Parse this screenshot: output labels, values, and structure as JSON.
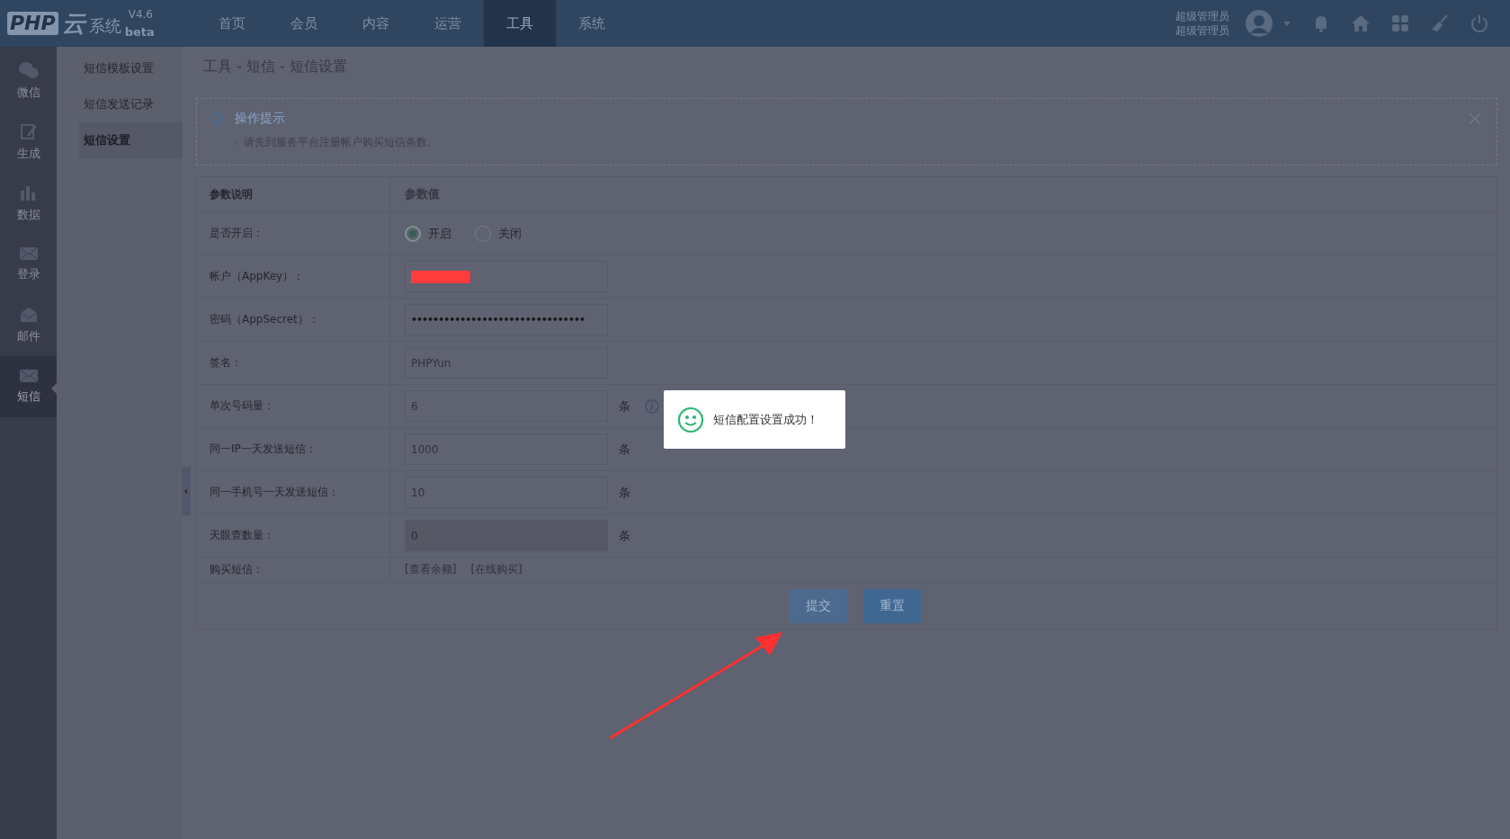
{
  "header": {
    "logo": {
      "mark": "PHP",
      "glyph": "云",
      "name": "系统",
      "version": "V4.6",
      "tag": "beta"
    },
    "nav": [
      {
        "label": "首页",
        "selected": false
      },
      {
        "label": "会员",
        "selected": false
      },
      {
        "label": "内容",
        "selected": false
      },
      {
        "label": "运营",
        "selected": false
      },
      {
        "label": "工具",
        "selected": true
      },
      {
        "label": "系统",
        "selected": false
      }
    ],
    "user": {
      "line_1": "超级管理员",
      "line_2": "超级管理员"
    }
  },
  "sidebar": {
    "items": [
      {
        "label": "微信",
        "selected": false
      },
      {
        "label": "生成",
        "selected": false
      },
      {
        "label": "数据",
        "selected": false
      },
      {
        "label": "登录",
        "selected": false
      },
      {
        "label": "邮件",
        "selected": false
      },
      {
        "label": "短信",
        "selected": true
      }
    ]
  },
  "collapse_handle": "‹",
  "submenu": {
    "items": [
      {
        "label": "短信模板设置",
        "selected": false
      },
      {
        "label": "短信发送记录",
        "selected": false
      },
      {
        "label": "短信设置",
        "selected": true
      }
    ]
  },
  "breadcrumb": "工具 - 短信 - 短信设置",
  "tip": {
    "title": "操作提示",
    "items": [
      "请先到服务平台注册帐户购买短信条数。"
    ]
  },
  "table": {
    "columns": [
      "参数说明",
      "参数值"
    ],
    "rows": [
      {
        "label": "是否开启：",
        "kind": "radio",
        "options": [
          {
            "label": "开启",
            "selected": true
          },
          {
            "label": "关闭",
            "selected": false
          }
        ]
      },
      {
        "label": "帐户（AppKey）：",
        "kind": "field",
        "redacted": true
      },
      {
        "label": "密码（AppSecret）：",
        "kind": "field",
        "value": "••••••••••••••••••••••••••••••••"
      },
      {
        "label": "签名：",
        "kind": "field",
        "value": "PHPYun"
      },
      {
        "label": "单次号码量：",
        "kind": "field",
        "value": "6",
        "unit": "条",
        "info": true
      },
      {
        "label": "同一IP一天发送短信：",
        "kind": "field",
        "value": "1000",
        "unit": "条"
      },
      {
        "label": "同一手机号一天发送短信：",
        "kind": "field",
        "value": "10",
        "unit": "条"
      },
      {
        "label": "天眼查数量：",
        "kind": "field",
        "value": "0",
        "unit": "条",
        "disabled": true
      },
      {
        "label": "购买短信：",
        "kind": "links",
        "links": [
          "[查看余额]",
          "[在线购买]"
        ]
      }
    ]
  },
  "buttons": [
    {
      "label": "提交",
      "kind": "submit"
    },
    {
      "label": "重置",
      "kind": "reset"
    }
  ],
  "toast": {
    "message": "短信配置设置成功！"
  }
}
